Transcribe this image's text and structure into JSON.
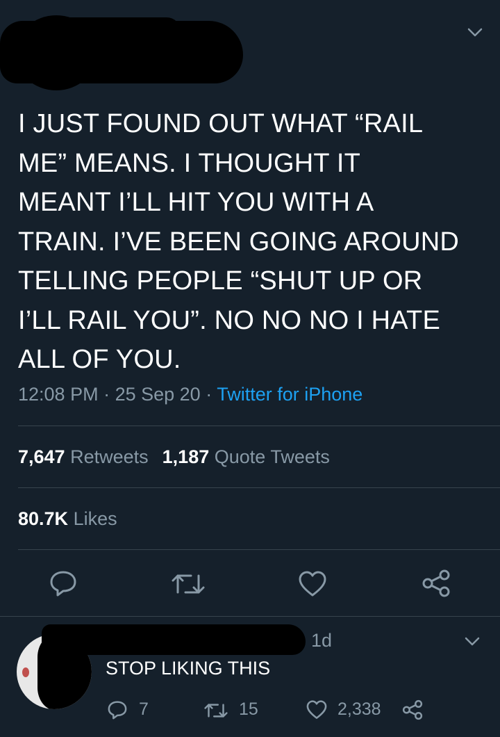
{
  "tweet": {
    "text": "I JUST FOUND OUT WHAT “RAIL\nME” MEANS. I THOUGHT IT\nMEANT I’LL HIT YOU WITH A\nTRAIN. I’VE BEEN GOING AROUND\nTELLING PEOPLE “SHUT UP OR\nI’LL RAIL YOU”. NO NO NO I HATE\nALL OF YOU.",
    "time": "12:08 PM",
    "sep1": " · ",
    "date": "25 Sep 20",
    "sep2": " · ",
    "source": "Twitter for iPhone",
    "retweets_count": "7,647",
    "retweets_label": "Retweets",
    "quotes_count": "1,187",
    "quotes_label": "Quote Tweets",
    "likes_count": "80.7K",
    "likes_label": "Likes"
  },
  "reply": {
    "time": "1d",
    "text": "STOP LIKING THIS",
    "reply_count": "7",
    "retweet_count": "15",
    "like_count": "2,338"
  },
  "colors": {
    "background": "#15202b",
    "secondary_text": "#8899a6",
    "link": "#1da1f2",
    "divider": "#38444d"
  },
  "icons": {
    "reply": "reply-icon",
    "retweet": "retweet-icon",
    "like": "heart-icon",
    "share": "share-icon",
    "more": "chevron-down-icon"
  }
}
